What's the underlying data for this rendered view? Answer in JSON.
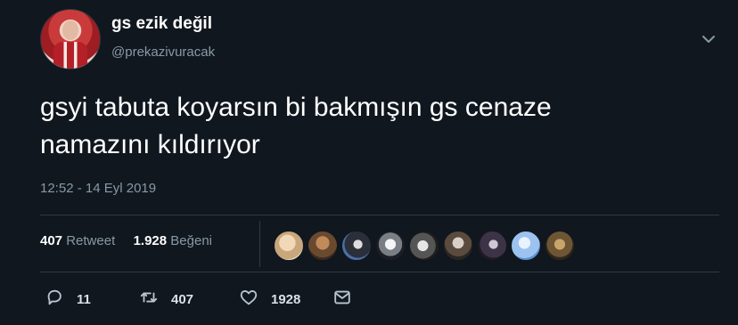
{
  "user": {
    "display_name": "gs ezik değil",
    "handle": "@prekazivuracak"
  },
  "tweet": {
    "text_line1": "gsyi tabuta koyarsın bi bakmışın gs cenaze",
    "text_line2": "namazını kıldırıyor",
    "timestamp": "12:52 - 14 Eyl 2019"
  },
  "stats": {
    "retweet_count": "407",
    "retweet_label": "Retweet",
    "like_count": "1.928",
    "like_label": "Beğeni"
  },
  "actions": {
    "reply_count": "11",
    "retweet_count": "407",
    "like_count": "1928"
  },
  "icons": [
    "chevron-down-icon",
    "reply-icon",
    "retweet-icon",
    "heart-icon",
    "message-icon"
  ],
  "colors": {
    "background": "#10171e",
    "text_primary": "#ffffff",
    "text_secondary": "#8899a6",
    "divider": "#2f3b47"
  }
}
